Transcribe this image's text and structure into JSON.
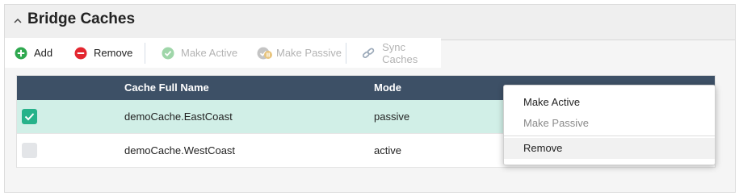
{
  "panel": {
    "title": "Bridge Caches",
    "collapse_icon": "chevron-up-icon"
  },
  "toolbar": {
    "add_label": "Add",
    "remove_label": "Remove",
    "make_active_label": "Make Active",
    "make_passive_label": "Make Passive",
    "sync_label": "Sync Caches"
  },
  "table": {
    "columns": [
      "",
      "Cache Full Name",
      "Mode"
    ],
    "rows": [
      {
        "checked": true,
        "name": "demoCache.EastCoast",
        "mode": "passive"
      },
      {
        "checked": false,
        "name": "demoCache.WestCoast",
        "mode": "active"
      }
    ]
  },
  "context_menu": {
    "items": [
      {
        "label": "Make Active",
        "enabled": true
      },
      {
        "label": "Make Passive",
        "enabled": false
      },
      {
        "label": "Remove",
        "enabled": true
      }
    ]
  },
  "colors": {
    "header_bg": "#3d5066",
    "selected_row": "#d1efe7",
    "checkbox_on": "#26b28a",
    "add_icon": "#2fa84f",
    "remove_icon": "#e3262f"
  }
}
